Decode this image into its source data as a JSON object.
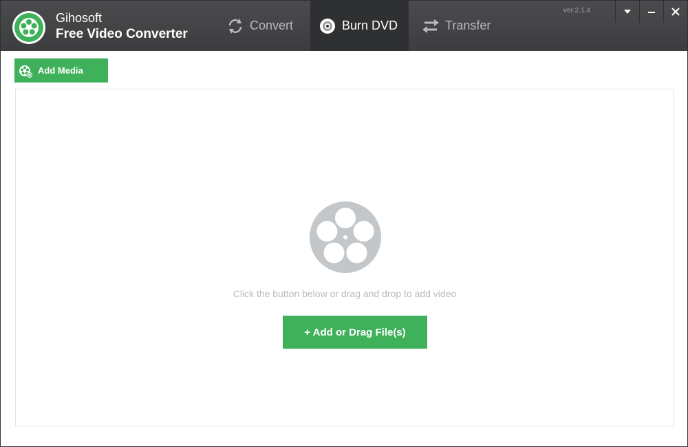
{
  "app": {
    "name": "Gihosoft",
    "product": "Free Video Converter",
    "version": "ver:2.1.4"
  },
  "tabs": [
    {
      "label": "Convert",
      "icon": "refresh-icon",
      "active": false
    },
    {
      "label": "Burn DVD",
      "icon": "disc-icon",
      "active": true
    },
    {
      "label": "Transfer",
      "icon": "transfer-arrows-icon",
      "active": false
    }
  ],
  "window_controls": {
    "menu": "▾",
    "minimize": "—",
    "close": "✕"
  },
  "toolbar": {
    "add_media_label": "Add Media"
  },
  "dropzone": {
    "hint": "Click the button below or drag and drop to add video",
    "add_button_label": "+ Add or Drag File(s)"
  },
  "colors": {
    "accent_green": "#3fb15a",
    "titlebar": "#3c3d3f",
    "active_tab": "#2f3032",
    "reel_gray": "#c4c7ca"
  }
}
